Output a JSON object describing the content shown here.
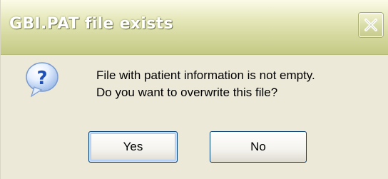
{
  "window": {
    "title": "GBI.PAT file exists",
    "close_icon": "close-icon"
  },
  "content": {
    "icon": "question-icon",
    "message_line1": "File with patient information is not empty.",
    "message_line2": "Do you want to overwrite this file?"
  },
  "buttons": {
    "yes_label": "Yes",
    "no_label": "No"
  },
  "colors": {
    "dialog_background": "#ece9d8",
    "titlebar": "#d3d79b",
    "button_border": "#003c74"
  }
}
